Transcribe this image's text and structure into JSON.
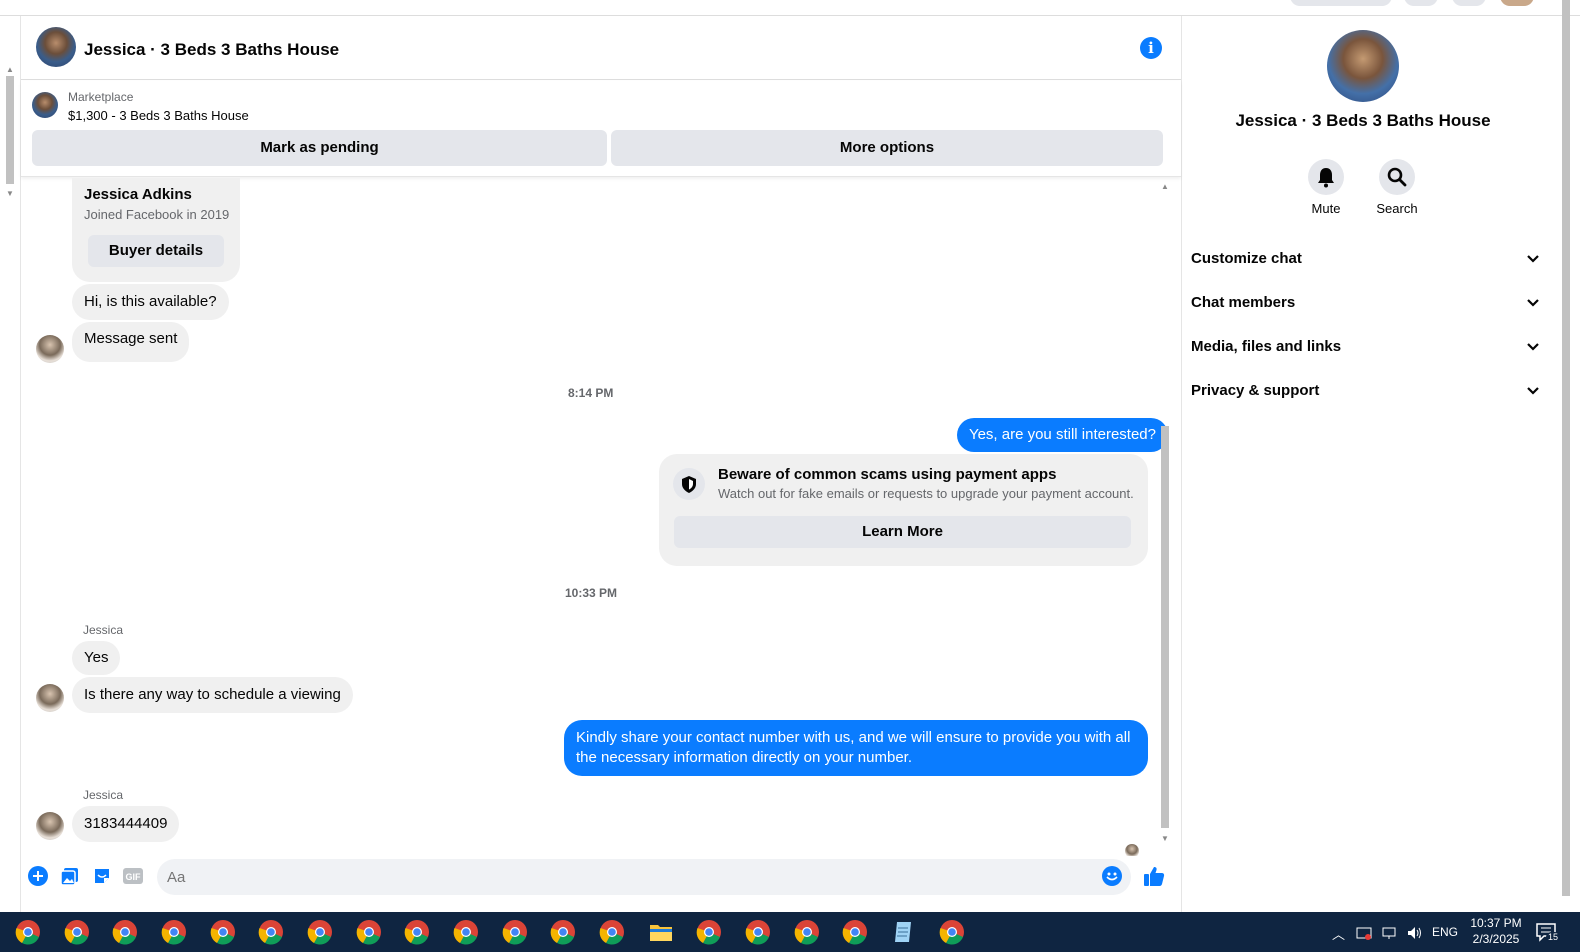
{
  "chat": {
    "title": "Jessica · 3 Beds 3 Baths House",
    "marketplace_label": "Marketplace",
    "listing": "$1,300 - 3 Beds 3 Baths House",
    "mark_pending": "Mark as pending",
    "more_options": "More options",
    "buyer_name": "Jessica Adkins",
    "buyer_joined": "Joined Facebook in 2019",
    "buyer_details": "Buyer details",
    "messages": {
      "m1": "Hi, is this available?",
      "m2": "Message sent",
      "ts1": "8:14 PM",
      "m3": "Yes, are you still interested?",
      "scam_title": "Beware of common scams using payment apps",
      "scam_body": "Watch out for fake emails or requests to upgrade your payment account.",
      "learn_more": "Learn More",
      "ts2": "10:33 PM",
      "sender1": "Jessica",
      "m4": "Yes",
      "m5": "Is there any way to schedule a viewing",
      "m6": "Kindly share your contact number with us, and we will ensure to provide you with all the necessary information directly on your number.",
      "sender2": "Jessica",
      "m7": "3183444409"
    },
    "composer_placeholder": "Aa"
  },
  "right_panel": {
    "title": "Jessica · 3 Beds 3 Baths House",
    "mute": "Mute",
    "search": "Search",
    "rows": [
      "Customize chat",
      "Chat members",
      "Media, files and links",
      "Privacy & support"
    ]
  },
  "taskbar": {
    "lang": "ENG",
    "time": "10:37 PM",
    "date": "2/3/2025",
    "notif_count": "15"
  },
  "colors": {
    "accent": "#0a7cff",
    "bubble_in": "#f0f0f0",
    "taskbar": "#0f2541"
  }
}
